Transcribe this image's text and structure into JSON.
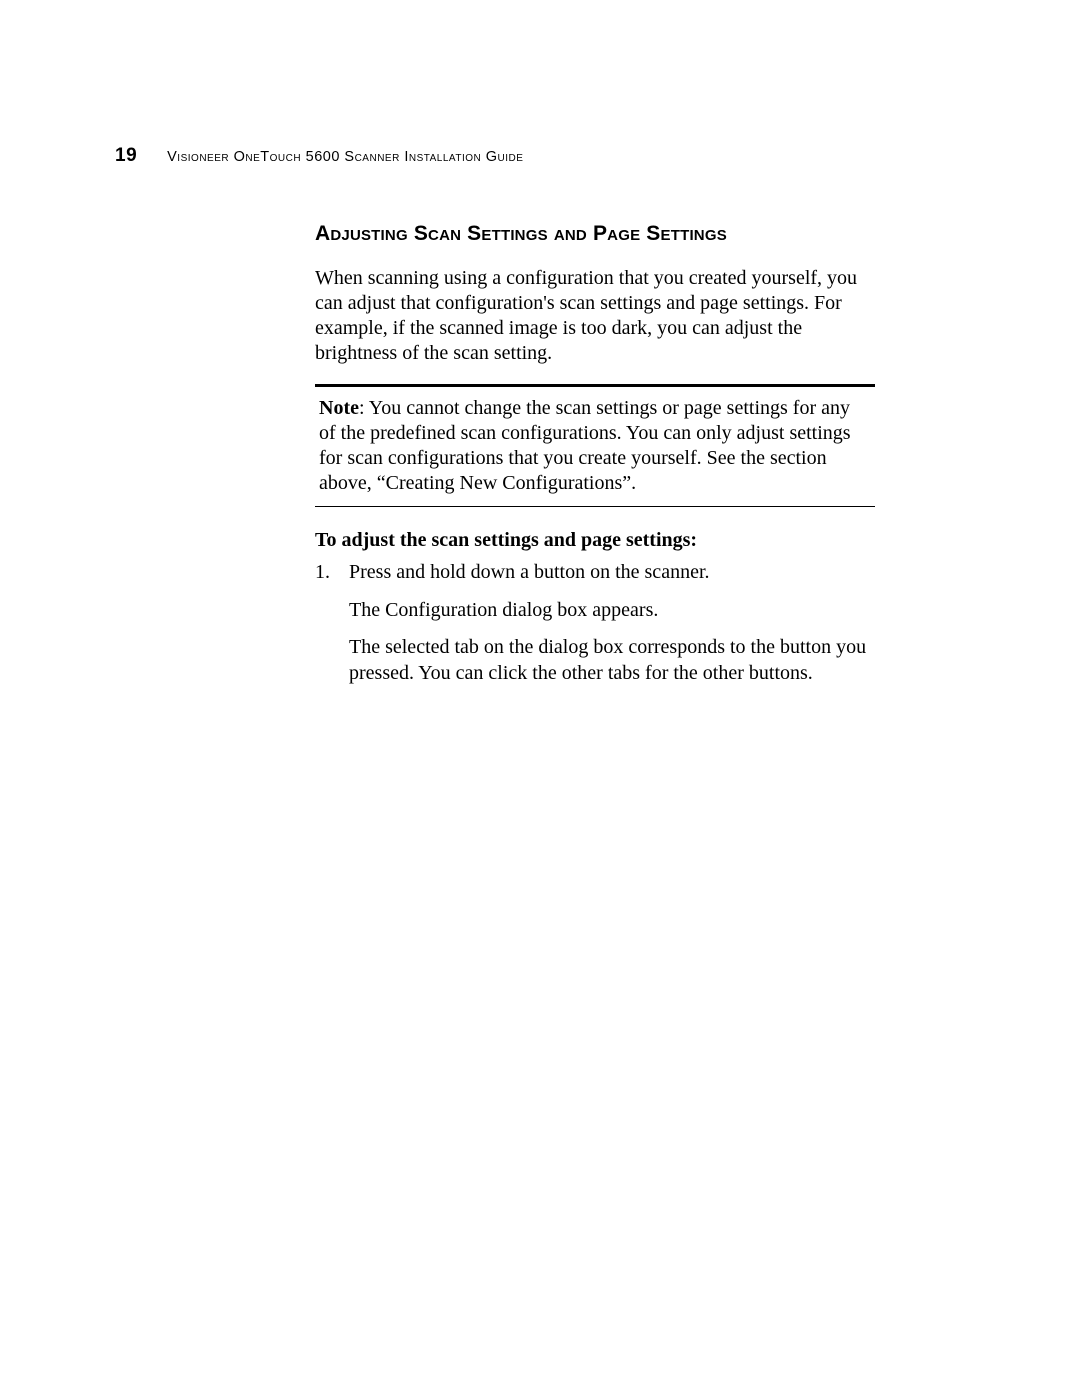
{
  "header": {
    "page_number": "19",
    "running_title": "Visioneer OneTouch 5600 Scanner Installation Guide"
  },
  "section": {
    "heading": "Adjusting Scan Settings and Page Settings",
    "intro": "When scanning using a configuration that you created yourself, you can adjust that configuration's scan settings and page settings. For example, if the scanned image is too dark, you can adjust the brightness of the scan setting.",
    "note_label": "Note",
    "note_text": ":  You cannot change the scan settings or page settings for any of the predefined scan configurations. You can only adjust settings for scan configurations that you create yourself. See the section above, “Creating New Configurations”.",
    "sub_heading": "To adjust the scan settings and page settings:",
    "list": {
      "num": "1.",
      "line1": "Press and hold down a button on the scanner.",
      "para1": "The Configuration dialog box appears.",
      "para2": "The selected tab on the dialog box corresponds to the button you pressed. You can click the other tabs for the other buttons."
    }
  }
}
